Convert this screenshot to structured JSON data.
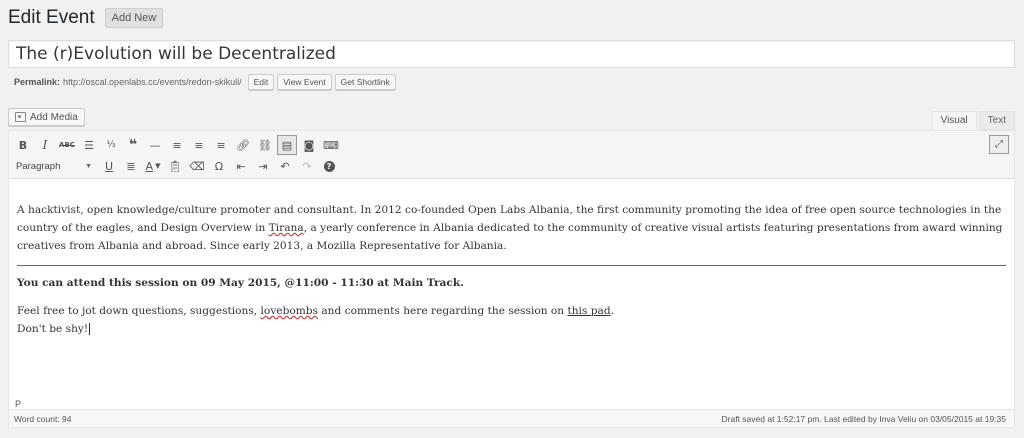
{
  "header": {
    "title": "Edit Event",
    "add_new": "Add New"
  },
  "post_title": {
    "value": "The (r)Evolution will be Decentralized"
  },
  "permalink": {
    "label": "Permalink:",
    "url": "http://oscal.openlabs.cc/events/redon-skikuli/",
    "edit": "Edit",
    "view": "View Event",
    "shortlink": "Get Shortlink"
  },
  "media": {
    "add_media": "Add Media"
  },
  "tabs": {
    "visual": "Visual",
    "text": "Text"
  },
  "toolbar": {
    "format_select": "Paragraph",
    "row1_icons": [
      "bold-icon",
      "italic-icon",
      "strikethrough-icon",
      "bullet-list-icon",
      "numbered-list-icon",
      "blockquote-icon",
      "horizontal-line-icon",
      "align-left-icon",
      "align-center-icon",
      "align-right-icon",
      "insert-link-icon",
      "remove-link-icon",
      "read-more-icon",
      "camera-icon",
      "toolbar-toggle-icon"
    ],
    "row2_icons": [
      "underline-icon",
      "justify-icon",
      "text-color-icon",
      "paste-text-icon",
      "clear-formatting-icon",
      "special-character-icon",
      "outdent-icon",
      "indent-icon",
      "undo-icon",
      "redo-icon",
      "help-icon"
    ]
  },
  "content": {
    "p1_a": "A hacktivist, open knowledge/culture promoter and consultant. In 2012 co-founded Open Labs Albania, the first community promoting the idea of free open source technologies in the country of the eagles, and Design Overview in ",
    "p1_tirana": "Tirana",
    "p1_b": ", a yearly conference in Albania dedicated to the community of creative visual artists featuring presentations from award winning creatives from Albania and abroad. Since early 2013, a Mozilla Representative for Albania.",
    "attend": "You can attend this session on 09 May 2015, @11:00 - 11:30 at Main Track.",
    "p3_a": "Feel free to jot down questions, suggestions, ",
    "p3_lovebombs": "lovebombs",
    "p3_b": " and comments here regarding the session on ",
    "p3_link": "this pad",
    "p3_c": ".",
    "p4": "Don't be shy!"
  },
  "status": {
    "path": "P",
    "word_count": "Word count: 94",
    "draft_saved": "Draft saved at 1:52:17 pm. Last edited by Inva Veliu on 03/05/2015 at 19:35"
  }
}
